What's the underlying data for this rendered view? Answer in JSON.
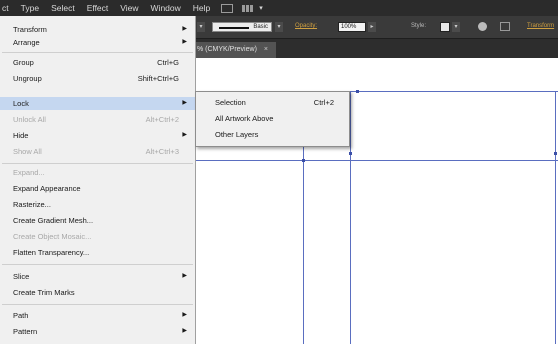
{
  "menubar": {
    "items": [
      "ct",
      "Type",
      "Select",
      "Effect",
      "View",
      "Window",
      "Help"
    ],
    "window_icon": "screen-mode-icon",
    "grid_icon": "arrange-documents-icon"
  },
  "controlbar": {
    "stroke_profile": "Basic",
    "opacity_label": "Opacity:",
    "opacity_value": "100%",
    "style_label": "Style:",
    "transform_label": "Transform"
  },
  "doc_tab": {
    "label": "% (CMYK/Preview)",
    "close": "×"
  },
  "object_menu": {
    "items": [
      {
        "label": "Transform",
        "submenu": true
      },
      {
        "label": "Arrange",
        "submenu": true
      },
      {
        "label": "Group",
        "shortcut": "Ctrl+G"
      },
      {
        "label": "Ungroup",
        "shortcut": "Shift+Ctrl+G"
      },
      {
        "label": "Lock",
        "submenu": true,
        "highlighted": true
      },
      {
        "label": "Unlock All",
        "shortcut": "Alt+Ctrl+2",
        "disabled": true
      },
      {
        "label": "Hide",
        "submenu": true
      },
      {
        "label": "Show All",
        "shortcut": "Alt+Ctrl+3",
        "disabled": true
      },
      {
        "label": "Expand...",
        "disabled": true
      },
      {
        "label": "Expand Appearance"
      },
      {
        "label": "Rasterize..."
      },
      {
        "label": "Create Gradient Mesh..."
      },
      {
        "label": "Create Object Mosaic...",
        "disabled": true
      },
      {
        "label": "Flatten Transparency..."
      },
      {
        "label": "Slice",
        "submenu": true
      },
      {
        "label": "Create Trim Marks"
      },
      {
        "label": "Path",
        "submenu": true
      },
      {
        "label": "Pattern",
        "submenu": true
      }
    ]
  },
  "lock_submenu": {
    "items": [
      {
        "label": "Selection",
        "shortcut": "Ctrl+2"
      },
      {
        "label": "All Artwork Above"
      },
      {
        "label": "Other Layers"
      }
    ]
  },
  "colors": {
    "menubar_bg": "#2b2b2b",
    "menu_bg": "#f0f0f0",
    "highlight": "#c5d7f0",
    "guide": "#5a6ec0"
  }
}
